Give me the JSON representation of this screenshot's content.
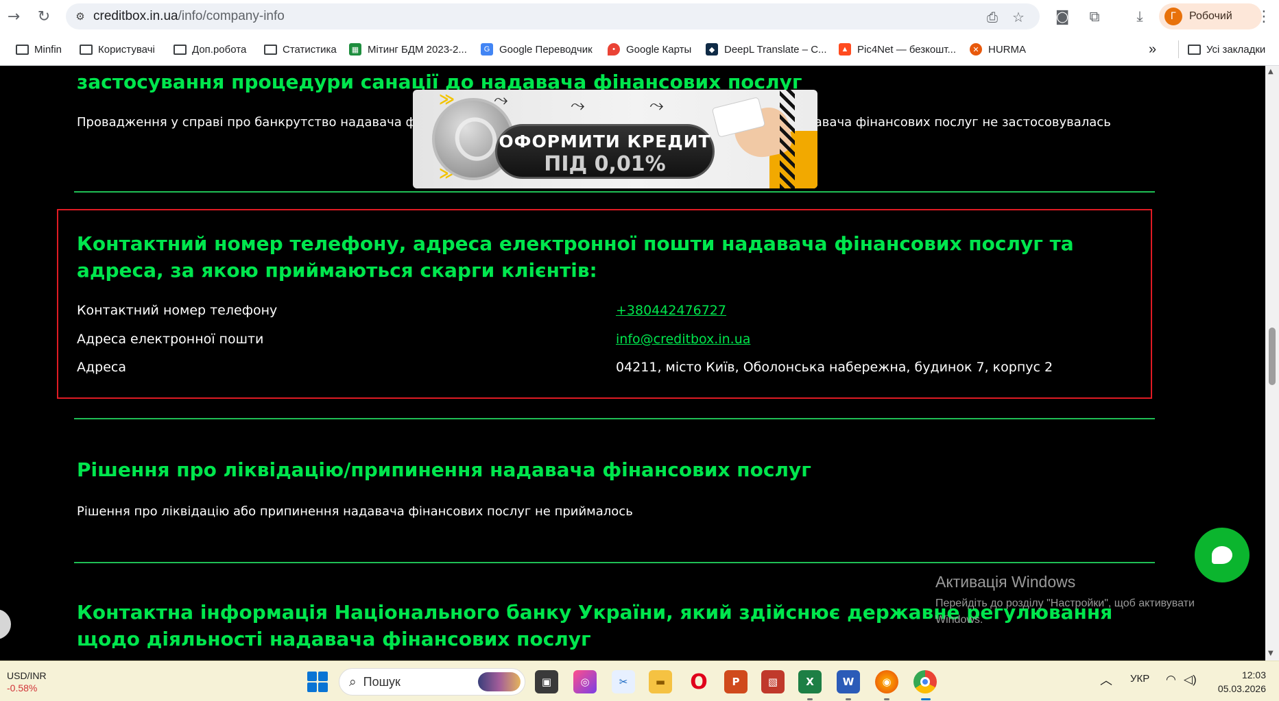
{
  "browser": {
    "url_host": "creditbox.in.ua",
    "url_path": "/info/company-info",
    "profile_initial": "Г",
    "profile_name": "Робочий",
    "bookmarks": [
      "Minfin",
      "Користувачі",
      "Доп.робота",
      "Статистика",
      "Мітинг БДМ 2023-2...",
      "Google Переводчик",
      "Google Карты",
      "DeepL Translate – C...",
      "Pic4Net — безкошт...",
      "HURMA"
    ],
    "overflow": "»",
    "all_bookmarks": "Усі закладки"
  },
  "page": {
    "section_top_heading": "застосування процедури санації до надавача фінансових послуг",
    "section_top_text": "Провадження у справі про банкрутство надавача фінансових послуг не відкривалась, процедура санації до надавача фінансових послуг не застосовувалась",
    "contacts": {
      "heading": "Контактний номер телефону, адреса електронної пошти надавача фінансових послуг та адреса, за якою приймаються скарги клієнтів:",
      "rows": [
        {
          "label": "Контактний номер телефону",
          "value": "+380442476727"
        },
        {
          "label": "Адреса електронної пошти",
          "value": "info@creditbox.in.ua"
        },
        {
          "label": "Адреса",
          "value": "04211, місто Київ, Оболонська набережна, будинок 7, корпус 2"
        }
      ]
    },
    "liquidation": {
      "heading": "Рішення про ліквідацію/припинення надавача фінансових послуг",
      "text": "Рішення про ліквідацію або припинення надавача фінансових послуг не приймалось"
    },
    "nbu": {
      "heading": "Контактна інформація Національного банку України, який здійснює державне регулювання щодо діяльності надавача фінансових послуг"
    },
    "banner": {
      "line1": "ОФОРМИТИ КРЕДИТ",
      "line2": "ПІД 0,01%"
    }
  },
  "windows_activation": {
    "title": "Активація Windows",
    "text": "Перейдіть до розділу \"Настройки\", щоб активувати Windows."
  },
  "taskbar": {
    "stock_name": "USD/INR",
    "stock_change": "-0.58%",
    "search_placeholder": "Пошук",
    "language": "УКР",
    "time": "12:03",
    "date": "05.03.2026"
  },
  "colors": {
    "accent_green": "#00e64d",
    "highlight_red": "#e01b24",
    "page_bg": "#000000"
  }
}
